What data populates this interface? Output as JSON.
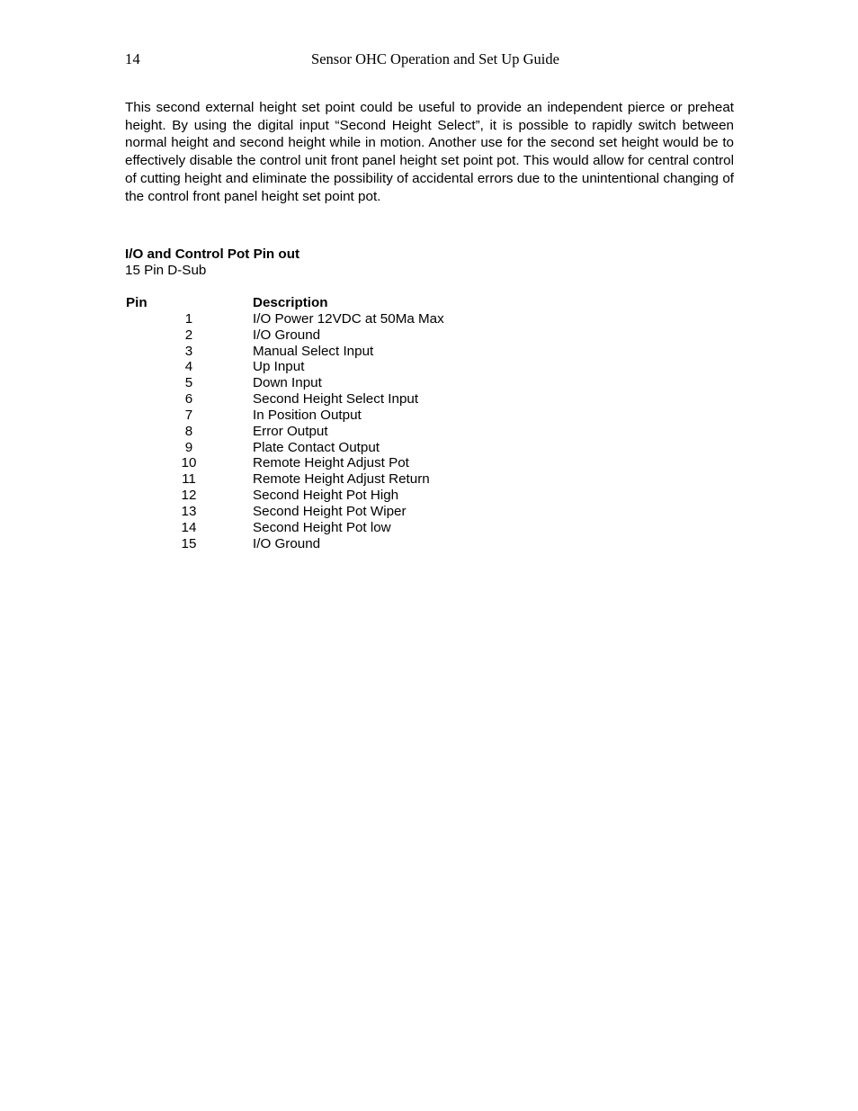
{
  "header": {
    "page_number": "14",
    "document_title": "Sensor OHC Operation and Set Up Guide"
  },
  "body": {
    "paragraph": "This second external height set point could be useful to provide an independent pierce or preheat height.  By using the digital input “Second Height Select”, it is possible to rapidly switch between normal height and second height while in motion.  Another use for the second set height would be to effectively disable the control unit front panel height set point pot.  This would allow for central control of cutting height and eliminate the possibility of accidental errors due to the unintentional changing of the control front panel height set point pot."
  },
  "section": {
    "title": "I/O and Control Pot Pin out",
    "subtitle": "15 Pin D-Sub"
  },
  "pinout_table": {
    "columns": [
      "Pin",
      "Description"
    ],
    "rows": [
      {
        "pin": "1",
        "description": "I/O Power 12VDC at 50Ma Max"
      },
      {
        "pin": "2",
        "description": "I/O Ground"
      },
      {
        "pin": "3",
        "description": "Manual Select Input"
      },
      {
        "pin": "4",
        "description": "Up Input"
      },
      {
        "pin": "5",
        "description": "Down Input"
      },
      {
        "pin": "6",
        "description": "Second Height Select Input"
      },
      {
        "pin": "7",
        "description": "In Position Output"
      },
      {
        "pin": "8",
        "description": "Error Output"
      },
      {
        "pin": "9",
        "description": "Plate Contact Output"
      },
      {
        "pin": "10",
        "description": "Remote Height Adjust Pot"
      },
      {
        "pin": "11",
        "description": "Remote Height Adjust Return"
      },
      {
        "pin": "12",
        "description": "Second Height Pot High"
      },
      {
        "pin": "13",
        "description": "Second Height Pot Wiper"
      },
      {
        "pin": "14",
        "description": "Second Height Pot low"
      },
      {
        "pin": "15",
        "description": "I/O Ground"
      }
    ]
  },
  "colors": {
    "page_background": "#ffffff",
    "text": "#000000"
  }
}
